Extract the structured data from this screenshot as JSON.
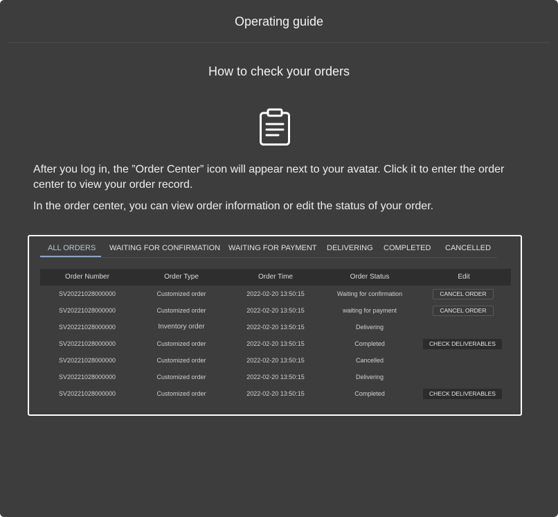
{
  "modal": {
    "title": "Operating guide",
    "section_title": "How to check your orders",
    "icon": "clipboard-icon",
    "paragraphs": [
      "After you log in, the ”Order Center” icon will appear next to your avatar. Click it to enter the order center to view your order record.",
      "In the order center, you can view order information or edit the status of your order."
    ]
  },
  "orders": {
    "tabs": [
      {
        "label": "ALL ORDERS",
        "active": true
      },
      {
        "label": "WAITING FOR CONFIRMATION",
        "active": false
      },
      {
        "label": "WAITING FOR PAYMENT",
        "active": false
      },
      {
        "label": "DELIVERING",
        "active": false
      },
      {
        "label": "COMPLETED",
        "active": false
      },
      {
        "label": "CANCELLED",
        "active": false
      }
    ],
    "columns": [
      "Order Number",
      "Order Type",
      "Order Time",
      "Order Status",
      "Edit"
    ],
    "rows": [
      {
        "number": "SV20221028000000",
        "type": "Customized order",
        "time": "2022-02-20 13:50:15",
        "status": "Waiting for confirmation",
        "action": "CANCEL ORDER"
      },
      {
        "number": "SV20221028000000",
        "type": "Customized order",
        "time": "2022-02-20 13:50:15",
        "status": "waiting for payment",
        "action": "CANCEL ORDER"
      },
      {
        "number": "SV20221028000000",
        "type": "Inventory order",
        "time": "2022-02-20 13:50:15",
        "status": "Delivering",
        "action": ""
      },
      {
        "number": "SV20221028000000",
        "type": "Customized order",
        "time": "2022-02-20 13:50:15",
        "status": "Completed",
        "action": "CHECK DELIVERABLES"
      },
      {
        "number": "SV20221028000000",
        "type": "Customized order",
        "time": "2022-02-20 13:50:15",
        "status": "Cancelled",
        "action": ""
      },
      {
        "number": "SV20221028000000",
        "type": "Customized order",
        "time": "2022-02-20 13:50:15",
        "status": "Delivering",
        "action": ""
      },
      {
        "number": "SV20221028000000",
        "type": "Customized order",
        "time": "2022-02-20 13:50:15",
        "status": "Completed",
        "action": "CHECK DELIVERABLES"
      }
    ]
  },
  "colors": {
    "background": "#3d3d3d",
    "active_tab": "#b8c6dc",
    "table_header": "#2e2e2e"
  }
}
